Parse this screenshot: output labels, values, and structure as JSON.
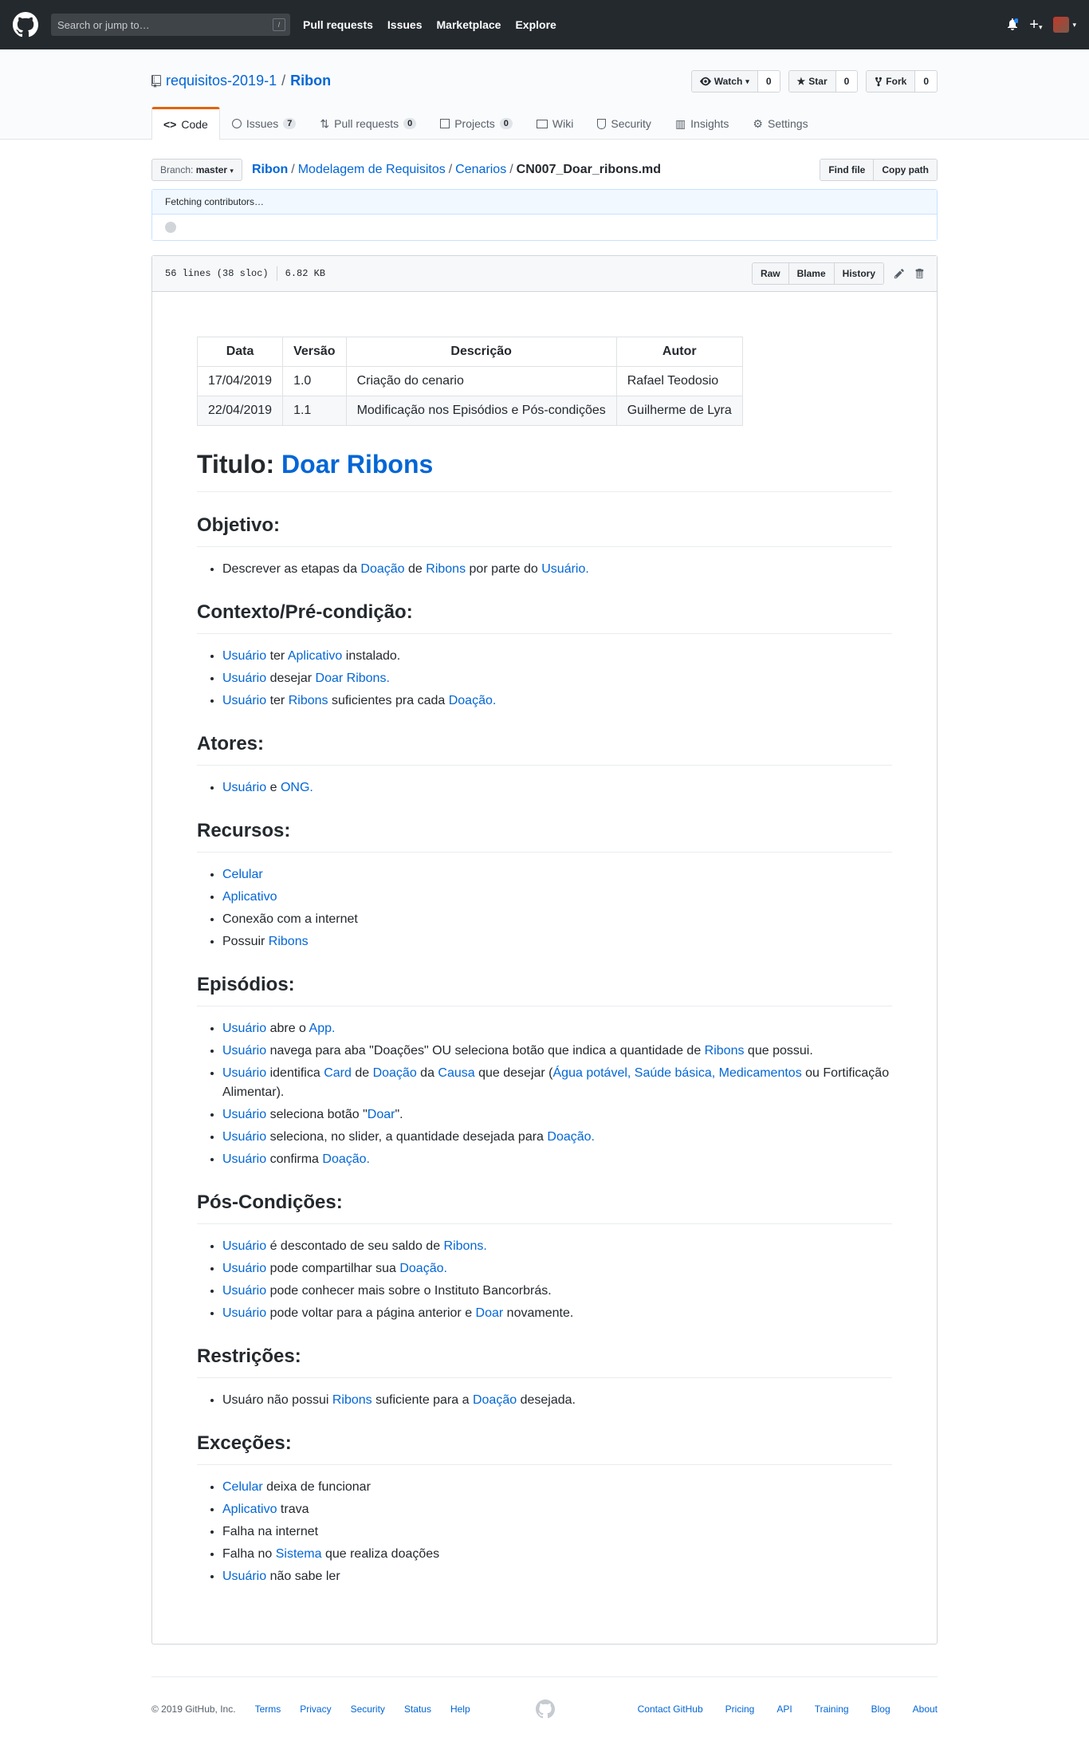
{
  "header": {
    "search_placeholder": "Search or jump to…",
    "search_key": "/",
    "nav": [
      "Pull requests",
      "Issues",
      "Marketplace",
      "Explore"
    ],
    "plus_label": "+"
  },
  "repo": {
    "owner": "requisitos-2019-1",
    "name": "Ribon",
    "watch_label": "Watch",
    "watch_count": "0",
    "star_label": "Star",
    "star_count": "0",
    "fork_label": "Fork",
    "fork_count": "0"
  },
  "tabs": [
    {
      "label": "Code",
      "count": ""
    },
    {
      "label": "Issues",
      "count": "7"
    },
    {
      "label": "Pull requests",
      "count": "0"
    },
    {
      "label": "Projects",
      "count": "0"
    },
    {
      "label": "Wiki",
      "count": ""
    },
    {
      "label": "Security",
      "count": ""
    },
    {
      "label": "Insights",
      "count": ""
    },
    {
      "label": "Settings",
      "count": ""
    }
  ],
  "filenav": {
    "branch_prefix": "Branch:",
    "branch": "master",
    "crumbs": [
      "Ribon",
      "Modelagem de Requisitos",
      "Cenarios"
    ],
    "filename": "CN007_Doar_ribons.md",
    "find_file": "Find file",
    "copy_path": "Copy path"
  },
  "commit": {
    "status": "Fetching contributors…"
  },
  "file": {
    "lines": "56 lines (38 sloc)",
    "size": "6.82 KB",
    "raw": "Raw",
    "blame": "Blame",
    "history": "History"
  },
  "history_table": {
    "headers": [
      "Data",
      "Versão",
      "Descrição",
      "Autor"
    ],
    "rows": [
      [
        "17/04/2019",
        "1.0",
        "Criação do cenario",
        "Rafael Teodosio"
      ],
      [
        "22/04/2019",
        "1.1",
        "Modificação nos Episódios e Pós-condições",
        "Guilherme de Lyra"
      ]
    ]
  },
  "doc": {
    "title_prefix": "Titulo: ",
    "title_link": "Doar Ribons",
    "sections": [
      {
        "heading": "Objetivo:",
        "items": [
          [
            [
              "t",
              "Descrever as etapas da "
            ],
            [
              "a",
              "Doação"
            ],
            [
              "t",
              " de "
            ],
            [
              "a",
              "Ribons"
            ],
            [
              "t",
              " por parte do "
            ],
            [
              "a",
              "Usuário."
            ]
          ]
        ]
      },
      {
        "heading": "Contexto/Pré-condição:",
        "items": [
          [
            [
              "a",
              "Usuário"
            ],
            [
              "t",
              " ter "
            ],
            [
              "a",
              "Aplicativo"
            ],
            [
              "t",
              " instalado."
            ]
          ],
          [
            [
              "a",
              "Usuário"
            ],
            [
              "t",
              " desejar "
            ],
            [
              "a",
              "Doar Ribons."
            ]
          ],
          [
            [
              "a",
              "Usuário"
            ],
            [
              "t",
              " ter "
            ],
            [
              "a",
              "Ribons"
            ],
            [
              "t",
              " suficientes pra cada "
            ],
            [
              "a",
              "Doação."
            ]
          ]
        ]
      },
      {
        "heading": "Atores:",
        "items": [
          [
            [
              "a",
              "Usuário"
            ],
            [
              "t",
              " e "
            ],
            [
              "a",
              "ONG."
            ]
          ]
        ]
      },
      {
        "heading": "Recursos:",
        "items": [
          [
            [
              "a",
              "Celular"
            ]
          ],
          [
            [
              "a",
              "Aplicativo"
            ]
          ],
          [
            [
              "t",
              "Conexão com a internet"
            ]
          ],
          [
            [
              "t",
              "Possuir "
            ],
            [
              "a",
              "Ribons"
            ]
          ]
        ]
      },
      {
        "heading": "Episódios:",
        "items": [
          [
            [
              "a",
              "Usuário"
            ],
            [
              "t",
              " abre o "
            ],
            [
              "a",
              "App."
            ]
          ],
          [
            [
              "a",
              "Usuário"
            ],
            [
              "t",
              " navega para aba \"Doações\" OU seleciona botão que indica a quantidade de "
            ],
            [
              "a",
              "Ribons"
            ],
            [
              "t",
              " que possui."
            ]
          ],
          [
            [
              "a",
              "Usuário"
            ],
            [
              "t",
              " identifica "
            ],
            [
              "a",
              "Card"
            ],
            [
              "t",
              " de "
            ],
            [
              "a",
              "Doação"
            ],
            [
              "t",
              " da "
            ],
            [
              "a",
              "Causa"
            ],
            [
              "t",
              " que desejar ("
            ],
            [
              "a",
              "Água potável, Saúde básica, Medicamentos"
            ],
            [
              "t",
              " ou Fortificação Alimentar)."
            ]
          ],
          [
            [
              "a",
              "Usuário"
            ],
            [
              "t",
              " seleciona botão \""
            ],
            [
              "a",
              "Doar"
            ],
            [
              "t",
              "\"."
            ]
          ],
          [
            [
              "a",
              "Usuário"
            ],
            [
              "t",
              " seleciona, no slider, a quantidade desejada para "
            ],
            [
              "a",
              "Doação."
            ]
          ],
          [
            [
              "a",
              "Usuário"
            ],
            [
              "t",
              " confirma "
            ],
            [
              "a",
              "Doação."
            ]
          ]
        ]
      },
      {
        "heading": "Pós-Condições:",
        "items": [
          [
            [
              "a",
              "Usuário"
            ],
            [
              "t",
              " é descontado de seu saldo de "
            ],
            [
              "a",
              "Ribons."
            ]
          ],
          [
            [
              "a",
              "Usuário"
            ],
            [
              "t",
              " pode compartilhar sua "
            ],
            [
              "a",
              "Doação."
            ]
          ],
          [
            [
              "a",
              "Usuário"
            ],
            [
              "t",
              " pode conhecer mais sobre o Instituto Bancorbrás."
            ]
          ],
          [
            [
              "a",
              "Usuário"
            ],
            [
              "t",
              " pode voltar para a página anterior e "
            ],
            [
              "a",
              "Doar"
            ],
            [
              "t",
              " novamente."
            ]
          ]
        ]
      },
      {
        "heading": "Restrições:",
        "items": [
          [
            [
              "t",
              "Usuáro não possui "
            ],
            [
              "a",
              "Ribons"
            ],
            [
              "t",
              " suficiente para a "
            ],
            [
              "a",
              "Doação"
            ],
            [
              "t",
              " desejada."
            ]
          ]
        ]
      },
      {
        "heading": "Exceções:",
        "items": [
          [
            [
              "a",
              "Celular"
            ],
            [
              "t",
              " deixa de funcionar"
            ]
          ],
          [
            [
              "a",
              "Aplicativo"
            ],
            [
              "t",
              " trava"
            ]
          ],
          [
            [
              "t",
              "Falha na internet"
            ]
          ],
          [
            [
              "t",
              "Falha no "
            ],
            [
              "a",
              "Sistema"
            ],
            [
              "t",
              " que realiza doações"
            ]
          ],
          [
            [
              "a",
              "Usuário"
            ],
            [
              "t",
              " não sabe ler"
            ]
          ]
        ]
      }
    ]
  },
  "footer": {
    "copyright": "© 2019 GitHub, Inc.",
    "left_links": [
      "Terms",
      "Privacy",
      "Security",
      "Status",
      "Help"
    ],
    "right_links": [
      "Contact GitHub",
      "Pricing",
      "API",
      "Training",
      "Blog",
      "About"
    ]
  }
}
